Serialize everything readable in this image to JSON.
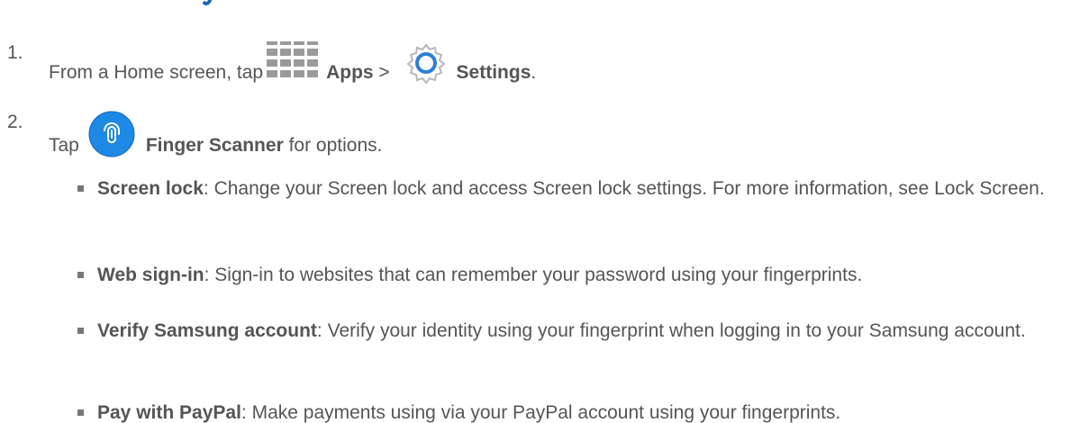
{
  "step1": {
    "number": "1.",
    "prefix": "From a Home screen, tap ",
    "apps_label": "Apps",
    "separator": " > ",
    "settings_label": "Settings",
    "suffix": "."
  },
  "step2": {
    "number": "2.",
    "prefix": "Tap ",
    "finger_label": "Finger Scanner",
    "suffix": " for options."
  },
  "options": [
    {
      "title": "Screen lock",
      "desc": ": Change your Screen lock and access Screen lock settings. For more information, see Lock Screen."
    },
    {
      "title": "Web sign-in",
      "desc": ": Sign-in to websites that can remember your password using your fingerprints."
    },
    {
      "title": "Verify Samsung account",
      "desc": ": Verify your identity using your fingerprint when logging in to your Samsung account."
    },
    {
      "title": "Pay with PayPal",
      "desc": ": Make payments using via your PayPal account using your fingerprints."
    }
  ],
  "icons": {
    "apps": "apps-grid-icon",
    "settings": "settings-gear-icon",
    "finger_scanner": "fingerprint-icon"
  },
  "colors": {
    "heading_blue": "#1f63b0",
    "text_gray": "#555555",
    "finger_icon_blue": "#1e88e5"
  }
}
